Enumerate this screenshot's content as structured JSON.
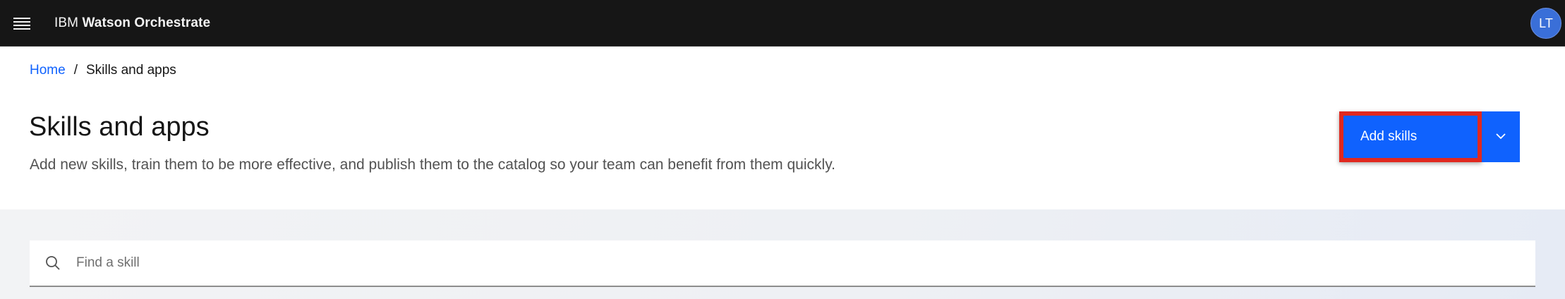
{
  "header": {
    "brand_prefix": "IBM",
    "brand_name": "Watson Orchestrate",
    "avatar_initials": "LT",
    "menu_icon": "hamburger-menu-icon"
  },
  "breadcrumb": {
    "home": "Home",
    "separator": "/",
    "current": "Skills and apps"
  },
  "page": {
    "title": "Skills and apps",
    "subtitle": "Add new skills, train them to be more effective, and publish them to the catalog so your team can benefit from them quickly."
  },
  "actions": {
    "add_skills_label": "Add skills",
    "dropdown_icon": "chevron-down-icon"
  },
  "search": {
    "placeholder": "Find a skill",
    "value": "",
    "icon": "search-icon"
  },
  "colors": {
    "header_bg": "#161616",
    "primary": "#0f62fe",
    "highlight": "#e0281f",
    "avatar_bg": "#3a6fd8"
  }
}
